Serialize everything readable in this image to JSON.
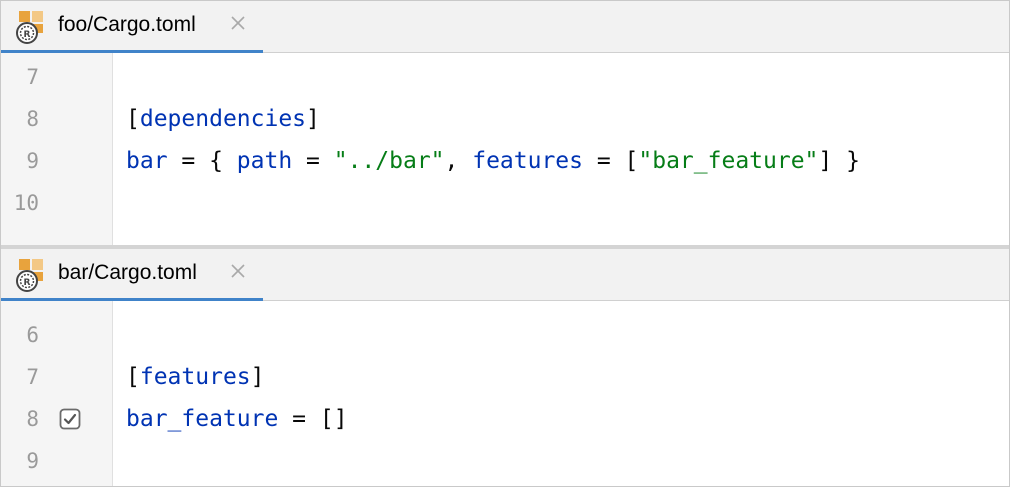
{
  "colors": {
    "key": "#0033b3",
    "string": "#067d17",
    "punct": "#080808",
    "tab_underline": "#4083c9"
  },
  "panes": [
    {
      "tab": {
        "label": "foo/Cargo.toml",
        "icon": "rust-toml-file-icon",
        "close": "×"
      },
      "line_numbers": [
        "7",
        "8",
        "9",
        "10"
      ],
      "code": {
        "line8": {
          "bracket_open": "[",
          "section": "dependencies",
          "bracket_close": "]"
        },
        "line9": {
          "key1": "bar",
          "eq1": " = { ",
          "key2": "path",
          "eq2": " = ",
          "val1": "\"../bar\"",
          "comma": ", ",
          "key3": "features",
          "eq3": " = [",
          "val2": "\"bar_feature\"",
          "close": "] }"
        }
      }
    },
    {
      "tab": {
        "label": "bar/Cargo.toml",
        "icon": "rust-toml-file-icon",
        "close": "×"
      },
      "line_numbers": [
        "6",
        "7",
        "8",
        "9"
      ],
      "gutter_marker": {
        "line": "8",
        "icon": "checkbox-checked-icon"
      },
      "code": {
        "line7": {
          "bracket_open": "[",
          "section": "features",
          "bracket_close": "]"
        },
        "line8": {
          "key": "bar_feature",
          "rest": " = []"
        }
      }
    }
  ]
}
